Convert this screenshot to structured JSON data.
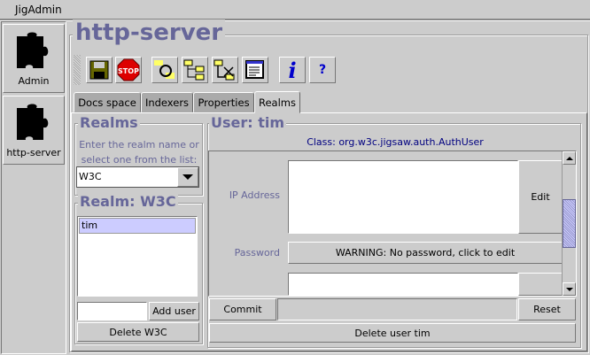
{
  "app": {
    "title": "JigAdmin"
  },
  "sidebar": {
    "items": [
      {
        "label": "Admin",
        "icon": "puzzle-icon"
      },
      {
        "label": "http-server",
        "icon": "puzzle-icon"
      }
    ]
  },
  "main": {
    "title": "http-server"
  },
  "toolbar": {
    "buttons": [
      {
        "icon": "save-icon"
      },
      {
        "icon": "stop-icon",
        "label": "STOP"
      },
      {
        "icon": "refresh-folders-icon"
      },
      {
        "icon": "folder-tree-icon"
      },
      {
        "icon": "delete-folder-icon"
      },
      {
        "icon": "document-icon"
      },
      {
        "icon": "info-icon",
        "label": "i"
      },
      {
        "icon": "help-icon",
        "label": "?"
      }
    ]
  },
  "tabs": [
    {
      "label": "Docs space"
    },
    {
      "label": "Indexers"
    },
    {
      "label": "Properties"
    },
    {
      "label": "Realms",
      "active": true
    }
  ],
  "realms": {
    "title": "Realms",
    "instructions_line1": "Enter the realm name or",
    "instructions_line2": "select one from the list:",
    "selected": "W3C"
  },
  "realm": {
    "title": "Realm: W3C",
    "users": [
      "tim"
    ],
    "new_user_value": "",
    "add_user": "Add user",
    "delete": "Delete W3C"
  },
  "user": {
    "title": "User: tim",
    "class_text": "Class: org.w3c.jigsaw.auth.AuthUser",
    "ip_label": "IP Address",
    "ip_value": "",
    "edit": "Edit",
    "password_label": "Password",
    "password_button": "WARNING: No password, click to edit",
    "commit": "Commit",
    "status": "",
    "reset": "Reset",
    "delete": "Delete user tim",
    "scroll_position": 0.5
  },
  "colors": {
    "accent": "#666699",
    "selection": "#ccccff",
    "class_text": "#000080"
  }
}
